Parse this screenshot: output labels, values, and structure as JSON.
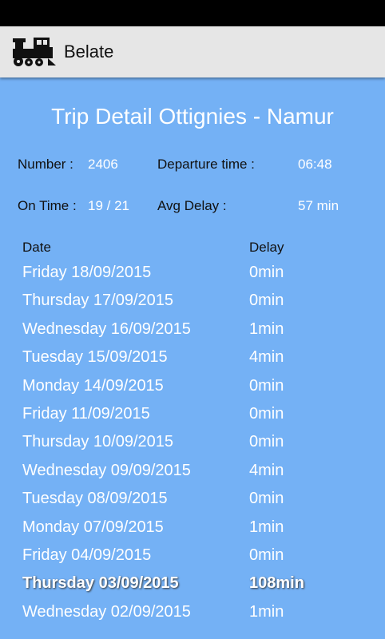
{
  "app": {
    "title": "Belate",
    "icon": "train-icon"
  },
  "trip": {
    "title": "Trip Detail Ottignies - Namur",
    "number_label": "Number :",
    "number_value": "2406",
    "departure_label": "Departure time :",
    "departure_value": "06:48",
    "ontime_label": "On Time :",
    "ontime_value": "19 / 21",
    "avgdelay_label": "Avg Delay :",
    "avgdelay_value": "57 min"
  },
  "table": {
    "headers": {
      "date": "Date",
      "delay": "Delay"
    },
    "rows": [
      {
        "date": "Friday 18/09/2015",
        "delay": "0min"
      },
      {
        "date": "Thursday 17/09/2015",
        "delay": "0min"
      },
      {
        "date": "Wednesday 16/09/2015",
        "delay": "1min"
      },
      {
        "date": "Tuesday 15/09/2015",
        "delay": "4min"
      },
      {
        "date": "Monday 14/09/2015",
        "delay": "0min"
      },
      {
        "date": "Friday 11/09/2015",
        "delay": "0min"
      },
      {
        "date": "Thursday 10/09/2015",
        "delay": "0min"
      },
      {
        "date": "Wednesday 09/09/2015",
        "delay": "4min"
      },
      {
        "date": "Tuesday 08/09/2015",
        "delay": "0min"
      },
      {
        "date": "Monday 07/09/2015",
        "delay": "1min"
      },
      {
        "date": "Friday 04/09/2015",
        "delay": "0min"
      },
      {
        "date": "Thursday 03/09/2015",
        "delay": "108min"
      },
      {
        "date": "Wednesday 02/09/2015",
        "delay": "1min"
      }
    ]
  },
  "colors": {
    "background": "#74b1f5",
    "action_bar": "#e6e6e6",
    "status_bar": "#000000"
  }
}
